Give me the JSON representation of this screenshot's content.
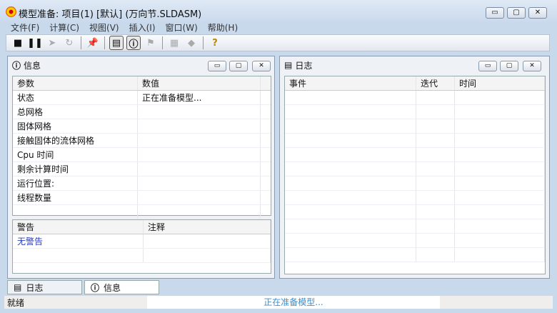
{
  "window": {
    "title": "模型准备: 项目(1) [默认] (万向节.SLDASM)",
    "min": "▭",
    "max": "▢",
    "close": "✕"
  },
  "menu": [
    "文件(F)",
    "计算(C)",
    "视图(V)",
    "插入(I)",
    "窗口(W)",
    "帮助(H)"
  ],
  "info_panel": {
    "title": "信息",
    "columns": [
      "参数",
      "数值"
    ],
    "rows": [
      [
        "状态",
        "正在准备模型..."
      ],
      [
        "总网格",
        ""
      ],
      [
        "固体网格",
        ""
      ],
      [
        "接触固体的流体网格",
        ""
      ],
      [
        "Cpu 时间",
        ""
      ],
      [
        "剩余计算时间",
        ""
      ],
      [
        "运行位置:",
        ""
      ],
      [
        "线程数量",
        ""
      ],
      [
        "",
        ""
      ]
    ],
    "warn_columns": [
      "警告",
      "注释"
    ],
    "warn_rows": [
      [
        "无警告",
        ""
      ],
      [
        "",
        ""
      ]
    ]
  },
  "log_panel": {
    "title": "日志",
    "columns": [
      "事件",
      "迭代",
      "时间"
    ]
  },
  "tabs": [
    "日志",
    "信息"
  ],
  "status": {
    "left": "就绪",
    "center": "正在准备模型..."
  },
  "colors": {
    "link": "#2b3fbf",
    "status_text": "#3a8fd0"
  }
}
